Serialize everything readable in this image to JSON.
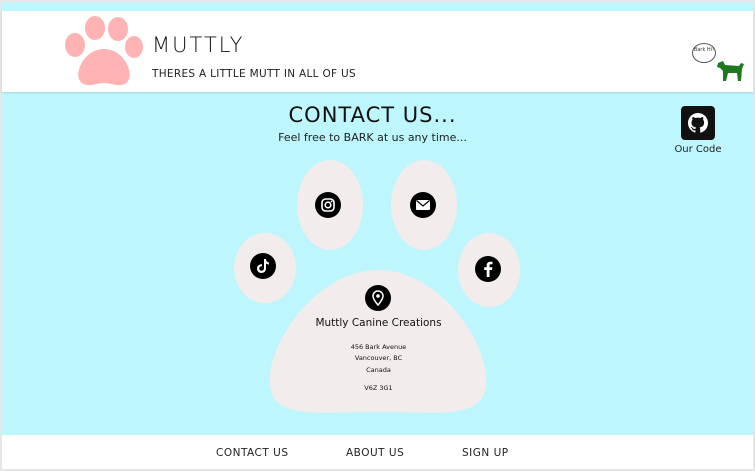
{
  "header": {
    "brand": "MUTTLY",
    "tagline": "THERES A LITTLE MUTT IN ALL OF US",
    "speech_bubble": "Bark Hi!",
    "icons": {
      "logo": "paw-logo-icon",
      "dog": "dog-icon"
    }
  },
  "main": {
    "title": "CONTACT US...",
    "subtitle": "Feel free to BARK at us any time...",
    "github_label": "Our Code"
  },
  "contact": {
    "icons": [
      "instagram-icon",
      "email-icon",
      "tiktok-icon",
      "facebook-icon",
      "location-pin-icon"
    ],
    "company": "Muttly Canine Creations",
    "address_line1": "456 Bark Avenue",
    "address_line2": "Vancouver, BC",
    "address_line3": "Canada",
    "postal": "V6Z 3G1"
  },
  "footer": {
    "links": [
      "CONTACT US",
      "ABOUT US",
      "SIGN UP"
    ]
  },
  "colors": {
    "background": "#bdf6fc",
    "header_bg": "#ffffff",
    "paw_logo": "#ffb3b3",
    "big_paw": "#f3ecec",
    "dog": "#1f7a1f"
  }
}
